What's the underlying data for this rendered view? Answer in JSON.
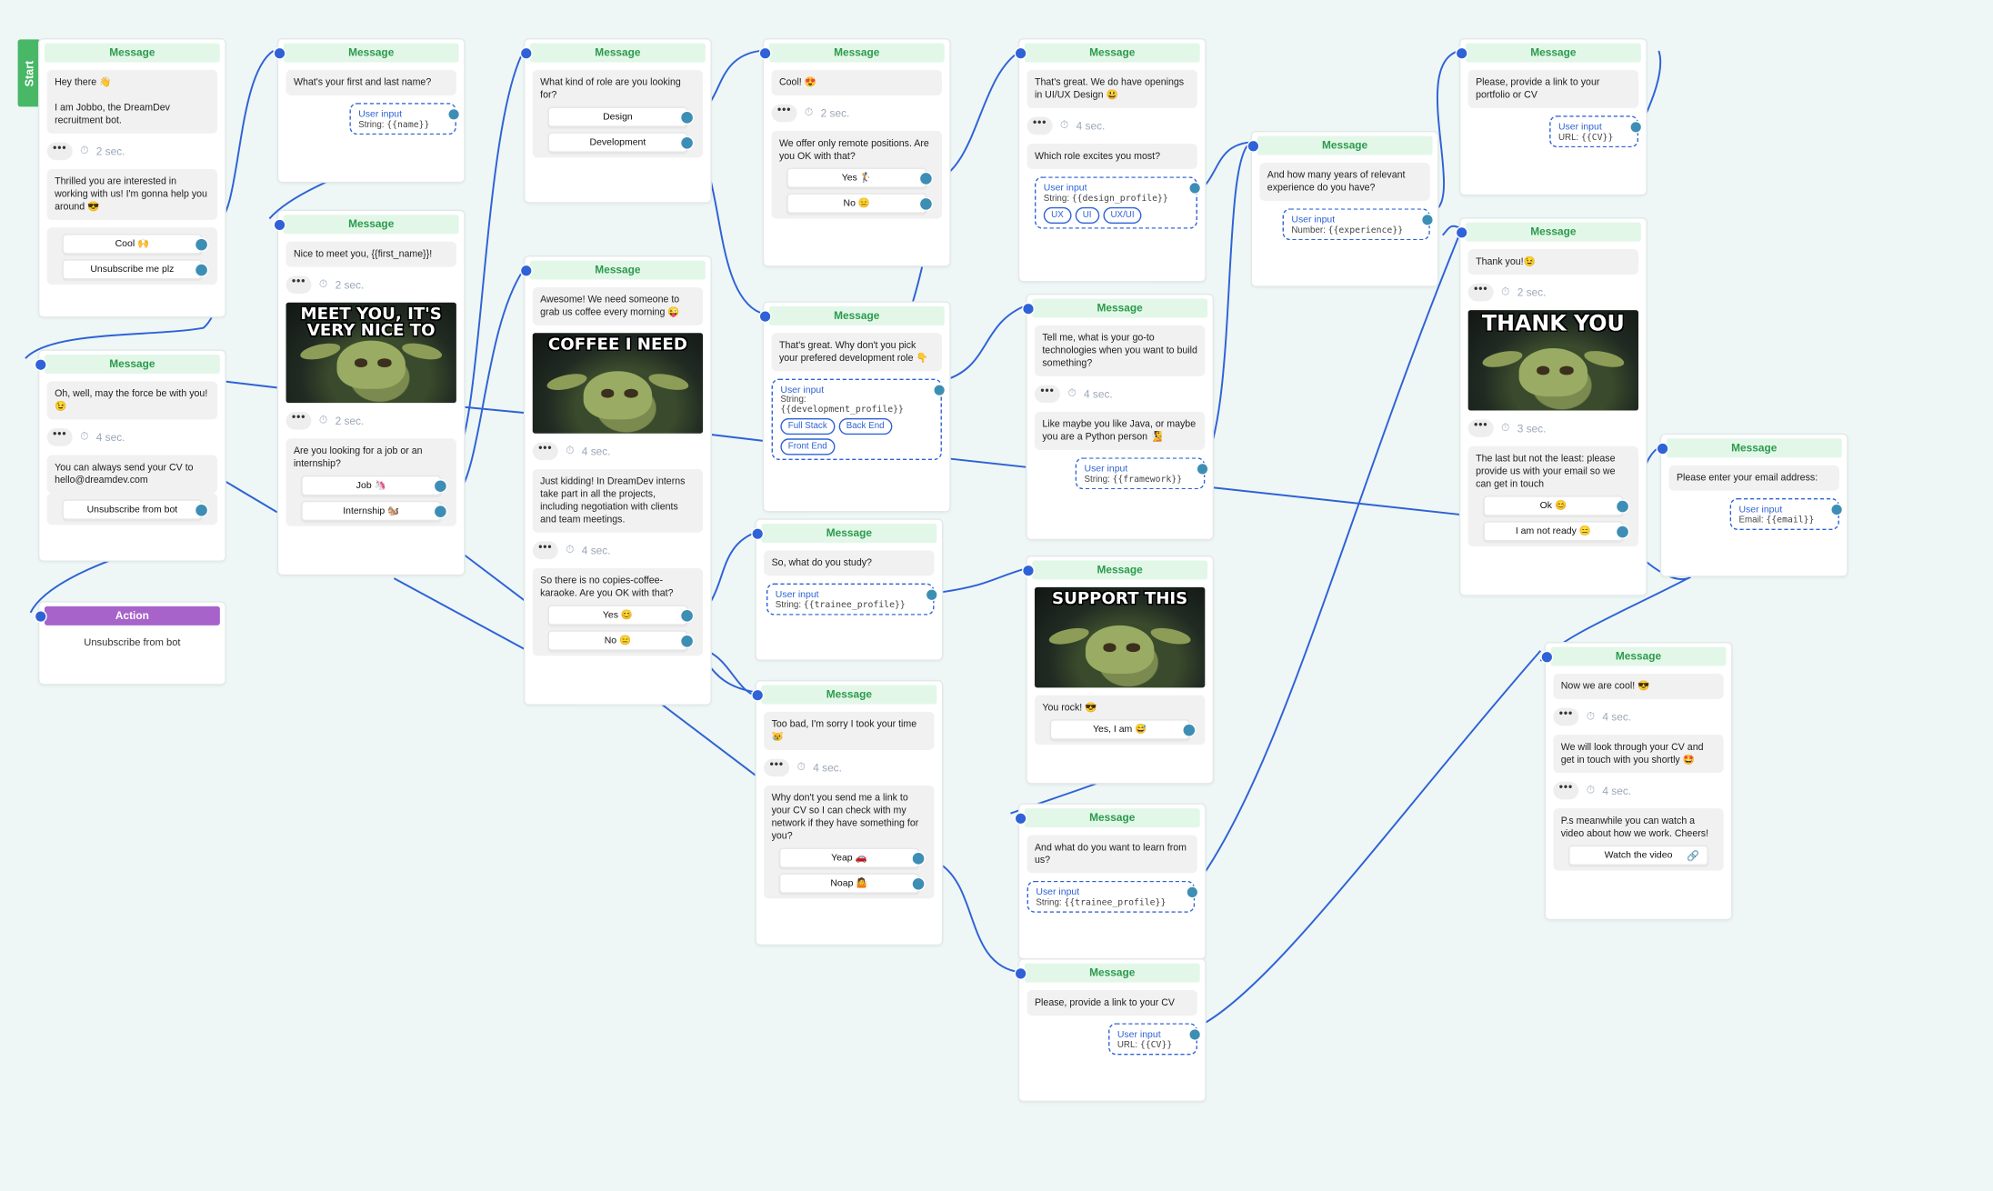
{
  "start_label": "Start",
  "delays": {
    "d2": "2 sec.",
    "d3": "3 sec.",
    "d4": "4 sec."
  },
  "user_input_label": "User input",
  "node_title": "Message",
  "n1": {
    "m1": "Hey there 👋\n\nI am Jobbo, the DreamDev recruitment bot.",
    "m2": "Thrilled you are interested in working with us! I'm gonna help you around 😎",
    "b1": "Cool 🙌",
    "b2": "Unsubscribe me plz"
  },
  "n2": {
    "m1": "Oh, well, may the force be with you! 😉",
    "m2": "You can always send your CV to hello@dreamdev.com",
    "b1": "Unsubscribe from bot"
  },
  "n3": {
    "title": "Action",
    "body": "Unsubscribe from bot"
  },
  "n4": {
    "m1": "What's your first and last name?",
    "type": "String:",
    "var": "{{name}}"
  },
  "n5": {
    "m1": "Nice to meet you,  {{first_name}}!",
    "caption": "MEET YOU, IT'S VERY NICE TO",
    "m2": "Are you looking for a job or an internship?",
    "b1": "Job 🦄",
    "b2": "Internship 🐿️"
  },
  "n6": {
    "m1": "What kind of role are you looking for?",
    "b1": "Design",
    "b2": "Development"
  },
  "n7": {
    "m1": "Awesome! We need someone to grab us coffee every morning 😜",
    "caption": "COFFEE I NEED",
    "m2": "Just kidding! In DreamDev interns take part in all the projects, including negotiation with clients and team meetings.",
    "m3": "So there is no copies-coffee-karaoke. Are you OK with that?",
    "b1": "Yes 😊",
    "b2": "No 😑"
  },
  "n8": {
    "m1": "Cool! 😍",
    "m2": "We offer only remote positions. Are you OK with that?",
    "b1": "Yes 🏌️",
    "b2": "No 😑"
  },
  "n9": {
    "m1": "That's great. Why don't you pick your prefered development role 👇",
    "type": "String:",
    "var": "{{development_profile}}",
    "chips": [
      "Full Stack",
      "Back End",
      "Front End"
    ]
  },
  "n10": {
    "m1": "So, what do you study?",
    "type": "String:",
    "var": "{{trainee_profile}}"
  },
  "n11": {
    "m1": "Too bad, I'm sorry I took your time 😿",
    "m2": "Why don't you send me a link to your CV so I can check with my network if they have something for you?",
    "b1": "Yeap 🚗",
    "b2": "Noap 🤷"
  },
  "n12": {
    "m1": "That's great. We do have openings in UI/UX Design 😃",
    "m2": "Which role excites you most?",
    "type": "String:",
    "var": "{{design_profile}}",
    "chips": [
      "UX",
      "UI",
      "UX/UI"
    ]
  },
  "n13": {
    "m1": "Tell me, what is your go-to technologies when you want to build something?",
    "m2": "Like maybe you like Java, or maybe you are a Python person 🧏",
    "type": "String:",
    "var": "{{framework}}"
  },
  "n14": {
    "caption": "SUPPORT THIS",
    "m1": "You rock! 😎",
    "b1": "Yes, I am 😅"
  },
  "n15": {
    "m1": "And what do you want to learn from us?",
    "type": "String:",
    "var": "{{trainee_profile}}"
  },
  "n16": {
    "m1": "Please, provide a link to your CV",
    "type": "URL:",
    "var": "{{CV}}"
  },
  "n17": {
    "m1": "And how many years of relevant experience do you have?",
    "type": "Number:",
    "var": "{{experience}}"
  },
  "n18": {
    "m1": "Please, provide a link to your portfolio or CV",
    "type": "URL:",
    "var": "{{CV}}"
  },
  "n19": {
    "m1": "Thank you!😉",
    "caption": "THANK YOU",
    "m2": "The last but not the least: please provide us with your email so we can get in touch",
    "b1": "Ok 😊",
    "b2": "I am not ready 😑"
  },
  "n20": {
    "m1": "Please enter your email address:",
    "type": "Email:",
    "var": "{{email}}"
  },
  "n21": {
    "m1": "Now we are cool! 😎",
    "m2": "We will look through your CV and get in touch with you shortly 🤩",
    "m3": "P.s meanwhile you can watch a video about how we work. Cheers!",
    "b1": "Watch the video"
  },
  "colors": {
    "wire": "#2f62d6",
    "header_bg": "#e2f7e8",
    "header_text": "#2c9a4c",
    "action": "#a763c9",
    "start": "#48b866",
    "canvas": "#eef7f6"
  }
}
